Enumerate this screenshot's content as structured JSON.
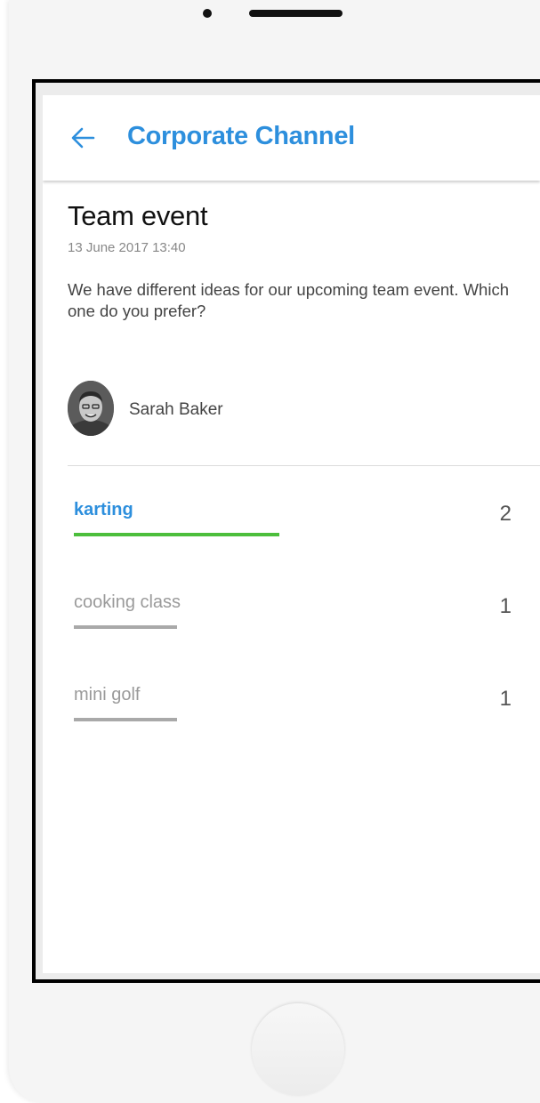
{
  "appbar": {
    "title": "Corporate Channel"
  },
  "post": {
    "title": "Team event",
    "date": "13 June 2017 13:40",
    "body": "We have different ideas for our upcoming team event. Which one do you prefer?"
  },
  "author": {
    "name": "Sarah Baker"
  },
  "poll": {
    "max_votes": 2,
    "options": [
      {
        "label": "karting",
        "votes": 2,
        "selected": true
      },
      {
        "label": "cooking class",
        "votes": 1,
        "selected": false
      },
      {
        "label": "mini golf",
        "votes": 1,
        "selected": false
      }
    ]
  },
  "colors": {
    "accent": "#2d8fdd",
    "selected_bar": "#4cbe3c",
    "unselected_bar": "#a9a9a9"
  }
}
